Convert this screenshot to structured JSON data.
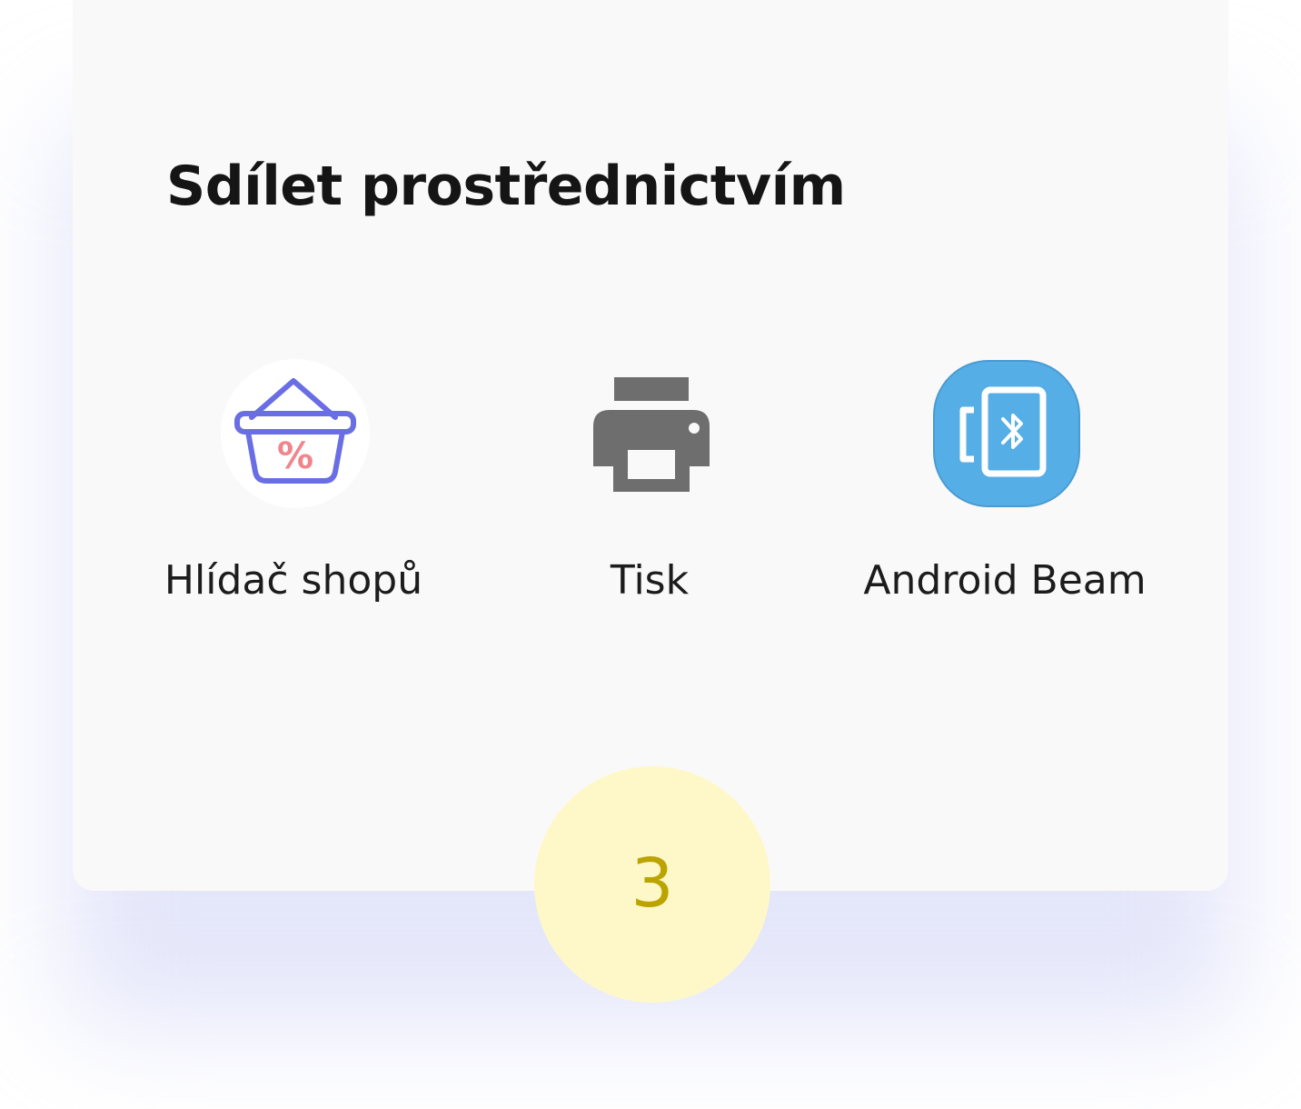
{
  "dialog": {
    "title": "Sdílet prostřednictvím"
  },
  "share_targets": [
    {
      "label": "Hlídač shopů",
      "icon": "shopping-basket-percent-icon",
      "accent": "#6a6ee4",
      "badge_color": "#f0868b"
    },
    {
      "label": "Tisk",
      "icon": "printer-icon",
      "accent": "#6e6e6e"
    },
    {
      "label": "Android Beam",
      "icon": "android-beam-icon",
      "accent": "#56aee6"
    }
  ],
  "step_badge": {
    "number": "3",
    "fill": "#fef8c9",
    "text_color": "#bba300"
  }
}
